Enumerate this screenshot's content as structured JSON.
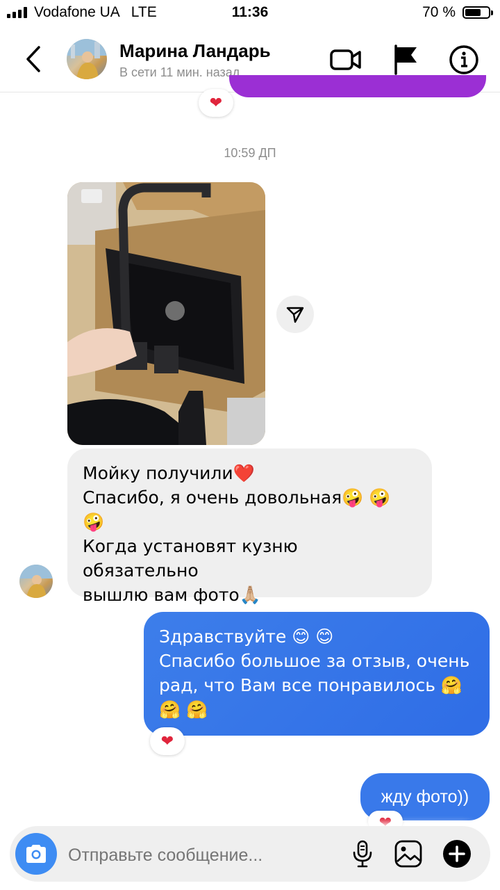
{
  "status_bar": {
    "carrier": "Vodafone UA",
    "network": "LTE",
    "time": "11:36",
    "battery": "70 %",
    "battery_level": 0.7
  },
  "header": {
    "contact_name": "Марина Ландарь",
    "presence": "В сети 11 мин. назад",
    "icons": [
      "chevron-left-icon",
      "video-call-icon",
      "flag-icon",
      "info-icon"
    ]
  },
  "messages": {
    "reaction_emoji": "❤",
    "timestamp": "10:59 ДП",
    "incoming_text": "Мойку получили❤️\nСпасибо, я очень довольная🤪 🤪\n🤪\nКогда установят кузню обязательно\nвышлю вам фото🙏🏼",
    "outgoing_text": "Здравствуйте 😊 😊\nСпасибо большое за отзыв, очень\nрад, что Вам все понравилось 🤗\n🤗 🤗",
    "outgoing_short": "жду фото))"
  },
  "composer": {
    "placeholder": "Отправьте сообщение...",
    "icons": [
      "camera-icon",
      "microphone-icon",
      "gallery-icon",
      "plus-icon"
    ]
  },
  "colors": {
    "outgoing_bubble": "#3979ea",
    "incoming_bubble": "#efefef",
    "reaction_heart": "#e0253c",
    "camera_button": "#3e8cf3"
  }
}
